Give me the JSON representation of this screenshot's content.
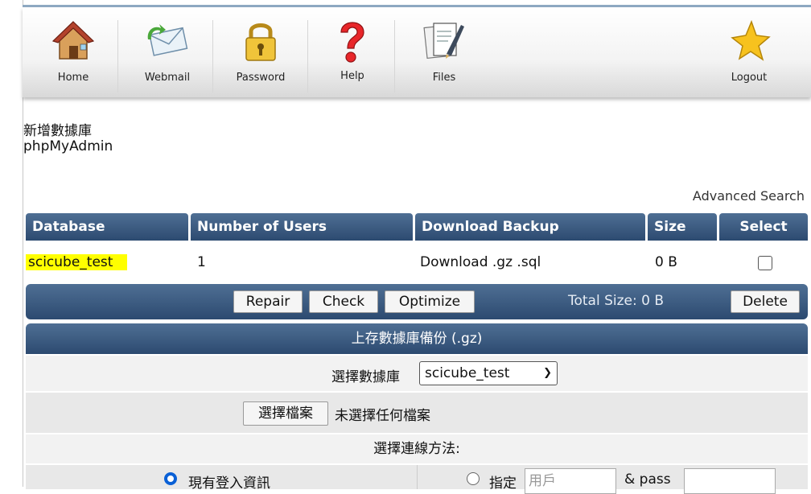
{
  "toolbar": {
    "items": [
      {
        "label": "Home",
        "icon": "house-icon"
      },
      {
        "label": "Webmail",
        "icon": "envelope-icon"
      },
      {
        "label": "Password",
        "icon": "padlock-icon"
      },
      {
        "label": "Help",
        "icon": "question-icon"
      },
      {
        "label": "Files",
        "icon": "files-icon"
      },
      {
        "label": "Logout",
        "icon": "star-icon"
      }
    ]
  },
  "links": {
    "new_db": "新增數據庫",
    "phpmyadmin": "phpMyAdmin",
    "advanced_search": "Advanced Search"
  },
  "table": {
    "headers": [
      "Database",
      "Number of Users",
      "Download Backup",
      "Size",
      "Select"
    ],
    "rows": [
      {
        "database": "scicube_test",
        "users": "1",
        "download": "Download .gz .sql",
        "size": "0 B"
      }
    ]
  },
  "actions": {
    "repair": "Repair",
    "check": "Check",
    "optimize": "Optimize",
    "total_size": "Total Size: 0 B",
    "delete": "Delete"
  },
  "upload": {
    "header": "上存數據庫備份 (.gz)",
    "select_db_label": "選擇數據庫",
    "select_db_value": "scicube_test",
    "choose_file_button": "選擇檔案",
    "no_file_text": "未選擇任何檔案",
    "connection_label": "選擇連線方法:",
    "option_current": "現有登入資訊",
    "option_specify": "指定",
    "user_placeholder": "用戶",
    "pass_label": "& pass"
  },
  "colors": {
    "header_bar": "#3b5b82",
    "highlight": "#ffff00",
    "radio_on": "#0a60d6"
  }
}
